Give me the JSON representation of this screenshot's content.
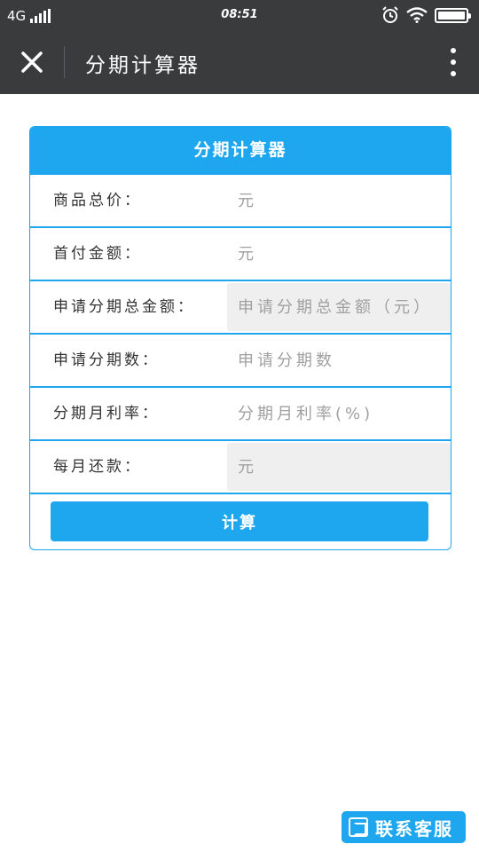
{
  "status_bar": {
    "network": "4G",
    "time": "08:51",
    "icons": [
      "signal-icon",
      "alarm-icon",
      "wifi-icon",
      "battery-icon"
    ],
    "battery_level": 1.0
  },
  "nav": {
    "title": "分期计算器",
    "icons": [
      "close-icon",
      "more-vertical-icon"
    ]
  },
  "card": {
    "title": "分期计算器",
    "rows": [
      {
        "label": "商品总价：",
        "placeholder": "元",
        "readonly": false
      },
      {
        "label": "首付金额：",
        "placeholder": "元",
        "readonly": false
      },
      {
        "label": "申请分期总金额：",
        "placeholder": "申请分期总金额（元）",
        "readonly": true
      },
      {
        "label": "申请分期数：",
        "placeholder": "申请分期数",
        "readonly": false
      },
      {
        "label": "分期月利率：",
        "placeholder": "分期月利率(%)",
        "readonly": false
      },
      {
        "label": "每月还款：",
        "placeholder": "元",
        "readonly": true
      }
    ],
    "button_label": "计算"
  },
  "service": {
    "label": "联系客服",
    "icon": "chat-icon"
  },
  "colors": {
    "accent": "#1ea7ee",
    "bar": "#3a3b3d",
    "readonly_bg": "#efefef"
  }
}
